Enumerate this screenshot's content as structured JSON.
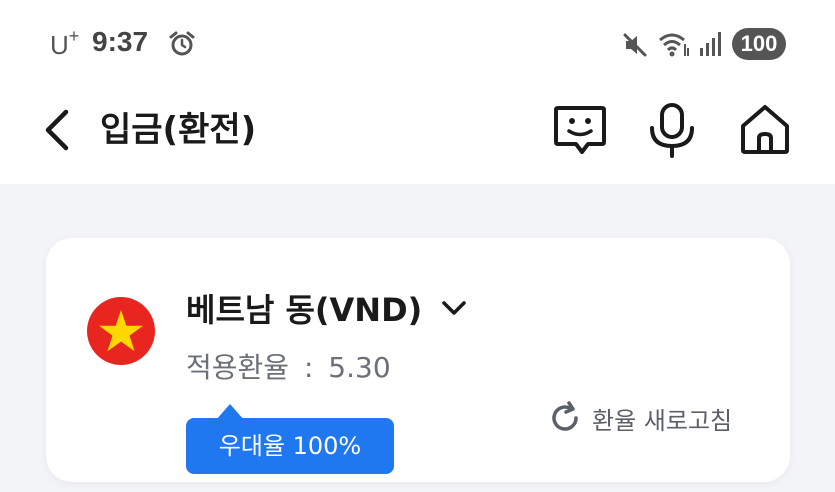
{
  "status_bar": {
    "carrier": "U",
    "carrier_sup": "+",
    "time": "9:37",
    "battery": "100",
    "icons": [
      "alarm-icon",
      "mute-icon",
      "wifi-icon",
      "signal-icon",
      "battery-icon"
    ]
  },
  "header": {
    "title": "입금(환전)",
    "icons": [
      "back-arrow-icon",
      "chatbot-icon",
      "microphone-icon",
      "home-icon"
    ]
  },
  "currency_card": {
    "currency_name": "베트남 동(VND)",
    "rate_label": "적용환율",
    "rate_separator": ":",
    "rate_value": "5.30",
    "preferential_badge": "우대율 100%",
    "refresh_label": "환율 새로고침",
    "flag_icon": "vietnam-flag-icon",
    "colors": {
      "flag_red": "#e8261f",
      "flag_star": "#ffd800",
      "badge_blue": "#1f78f0"
    }
  }
}
